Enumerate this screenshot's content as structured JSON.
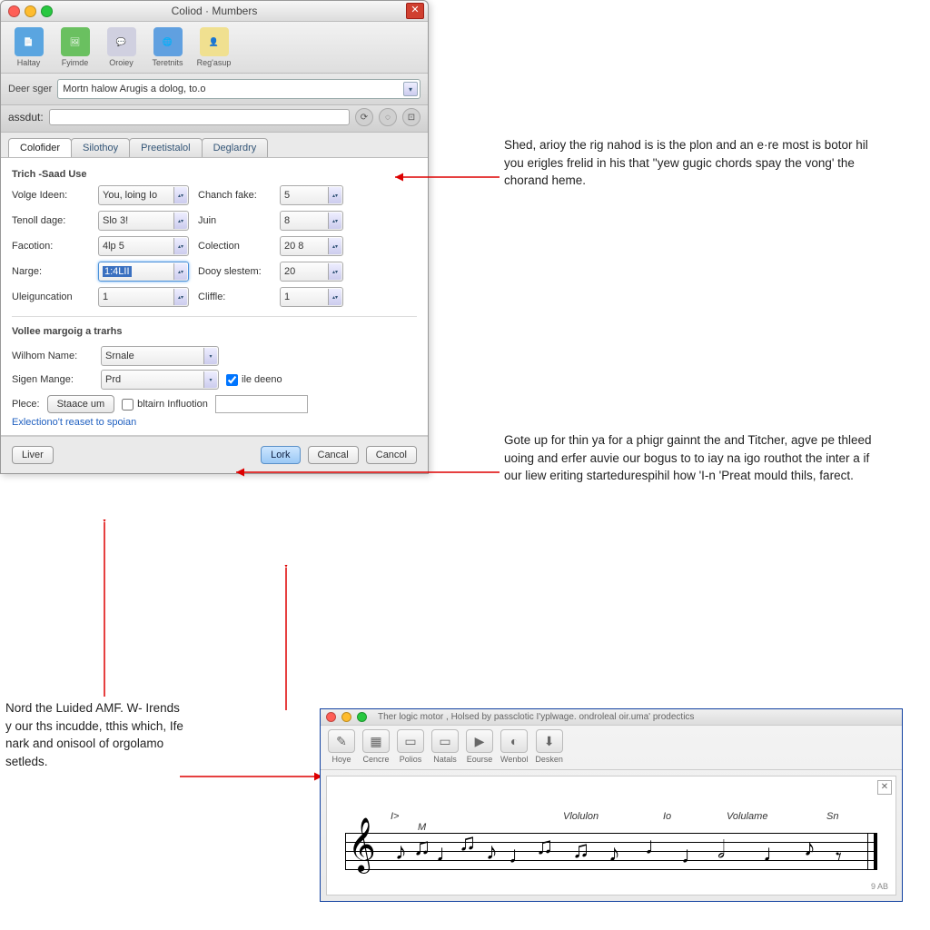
{
  "dialog": {
    "title": "Coliod · Mumbers",
    "toolbar": [
      {
        "label": "Haltay",
        "icon": "📄",
        "color": "#5aa5e0"
      },
      {
        "label": "Fyimde",
        "icon": "🖼",
        "color": "#6ac060"
      },
      {
        "label": "Oroiey",
        "icon": "💬",
        "color": "#c0c0d0"
      },
      {
        "label": "Teretnits",
        "icon": "🌐",
        "color": "#60a0e0"
      },
      {
        "label": "Reg'asup",
        "icon": "👤",
        "color": "#e0c050"
      }
    ],
    "searchLabel": "Deer sger",
    "searchValue": "Mortn halow Arugis a dolog, to.o",
    "subLabel": "assdut:",
    "tabs": [
      "Colofider",
      "Silothoy",
      "Preetistalol",
      "Deglardry"
    ],
    "activeTab": 0,
    "group1": "Trich -Saad Use",
    "fields": [
      {
        "l1": "Volge Ideen:",
        "v1": "You, loing Io",
        "l2": "Chanch fake:",
        "v2": "5"
      },
      {
        "l1": "Tenoll dage:",
        "v1": "Slo 3!",
        "l2": "Juin",
        "v2": "8"
      },
      {
        "l1": "Facotion:",
        "v1": "4lp 5",
        "l2": "Colection",
        "v2": "20 8"
      },
      {
        "l1": "Narge:",
        "v1": "1:4LII",
        "l2": "Dooy slestem:",
        "v2": "20",
        "hl": true
      },
      {
        "l1": "Uleiguncation",
        "v1": "1",
        "l2": "Cliffle:",
        "v2": "1"
      }
    ],
    "group2": "Vollee margoig a trarhs",
    "wilhomLabel": "Wilhom Name:",
    "wilhomValue": "Srnale",
    "sigenLabel": "Sigen Mange:",
    "sigenValue": "Prd",
    "chk1": "ile deeno",
    "pleeLabel": "Plece:",
    "pleeBtn": "Staace um",
    "chk2": "bltairn Influotion",
    "linkText": "Exlectiono't reaset to spoian",
    "btnLeft": "Liver",
    "btnPrimary": "Lork",
    "btnCancel1": "Cancal",
    "btnCancel2": "Cancol"
  },
  "callouts": {
    "c1": "Shed, arioy the rig nahod is is the plon and an e·re most is botor hil you erigles frelid in his that ''yew gugic chords spay the vong' the chorand heme.",
    "c2": "Gote up for thin ya for a phigr gainnt the and Titcher, agve pe thleed uoing and erfer auvie our bogus to to iay na igo routhot the inter a if our liew eriting startedurespihil how 'I-n 'Preat mould thils, farect.",
    "c3": "Nord the Luided AMF. W- Irends y our ths incudde, tthis which, Ife nark and onisool of orgolamo setleds."
  },
  "music": {
    "title": "Ther logic motor , Holsed by passclotic I'yplwage. ondroleal oir.uma' prodectics",
    "toolbar": [
      {
        "label": "Hoye",
        "icon": "✎"
      },
      {
        "label": "Cencre",
        "icon": "▦"
      },
      {
        "label": "Polios",
        "icon": "▭"
      },
      {
        "label": "Natals",
        "icon": "▭"
      },
      {
        "label": "Eourse",
        "icon": "▶"
      },
      {
        "label": "Wenbol",
        "icon": "◐"
      },
      {
        "label": "Desken",
        "icon": "⬇"
      }
    ],
    "markers": [
      "I>",
      "M",
      "Vlolulon",
      "Io",
      "Volulame",
      "Sn"
    ],
    "footer": "9 AB"
  }
}
